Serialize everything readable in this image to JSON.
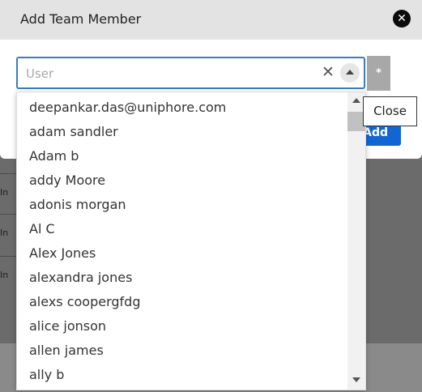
{
  "modal": {
    "title": "Add Team Member",
    "user_field": {
      "placeholder": "User",
      "value": ""
    },
    "required_marker": "*",
    "add_label": "Add",
    "close_tooltip": "Close"
  },
  "user_options": [
    "deepankar.das@uniphore.com",
    "adam sandler",
    "Adam b",
    "addy Moore",
    "adonis morgan",
    "Al C",
    "Alex Jones",
    "alexandra jones",
    "alexs coopergfdg",
    "alice jonson",
    "allen james",
    "ally b"
  ],
  "background_rows": [
    "In",
    "In",
    "In"
  ],
  "icons": {
    "close": "close-circle-icon",
    "clear": "clear-x-icon",
    "toggle": "triangle-up-icon",
    "scroll_up": "scroll-up-arrow-icon",
    "scroll_down": "scroll-down-arrow-icon"
  },
  "colors": {
    "accent": "#1266d4",
    "input_border": "#3d7bc4",
    "header_bg": "#e3e3e3"
  }
}
